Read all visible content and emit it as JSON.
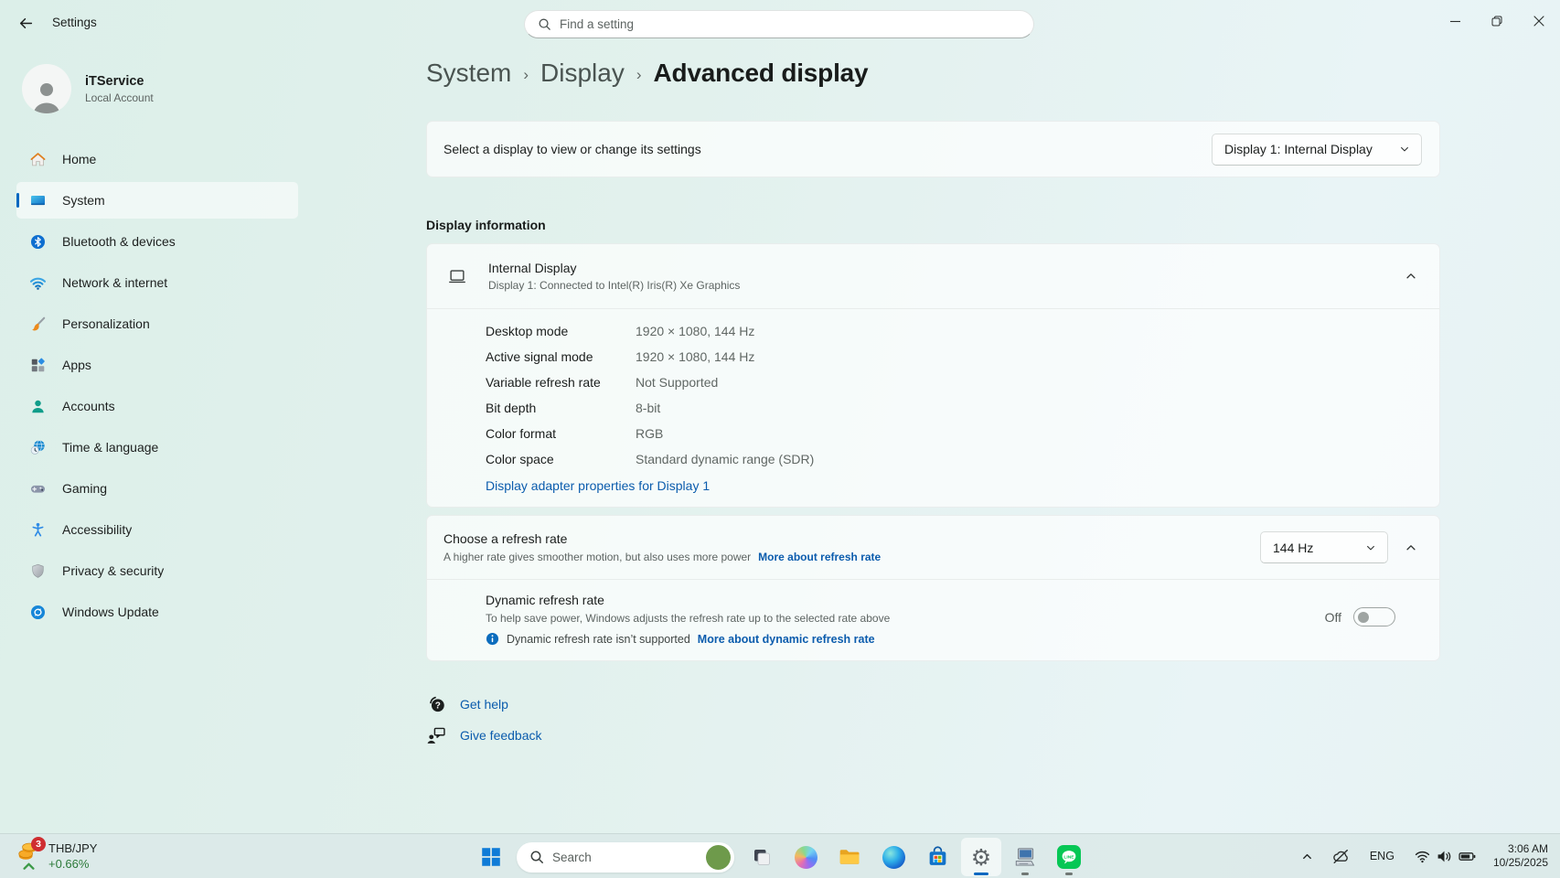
{
  "window": {
    "app_title": "Settings",
    "search_placeholder": "Find a setting"
  },
  "user": {
    "name": "iTService",
    "account_type": "Local Account"
  },
  "sidebar": {
    "items": [
      {
        "label": "Home",
        "icon": "home-icon",
        "selected": false
      },
      {
        "label": "System",
        "icon": "system-icon",
        "selected": true
      },
      {
        "label": "Bluetooth & devices",
        "icon": "bluetooth-icon",
        "selected": false
      },
      {
        "label": "Network & internet",
        "icon": "network-icon",
        "selected": false
      },
      {
        "label": "Personalization",
        "icon": "personalization-icon",
        "selected": false
      },
      {
        "label": "Apps",
        "icon": "apps-icon",
        "selected": false
      },
      {
        "label": "Accounts",
        "icon": "accounts-icon",
        "selected": false
      },
      {
        "label": "Time & language",
        "icon": "time-language-icon",
        "selected": false
      },
      {
        "label": "Gaming",
        "icon": "gaming-icon",
        "selected": false
      },
      {
        "label": "Accessibility",
        "icon": "accessibility-icon",
        "selected": false
      },
      {
        "label": "Privacy & security",
        "icon": "privacy-security-icon",
        "selected": false
      },
      {
        "label": "Windows Update",
        "icon": "windows-update-icon",
        "selected": false
      }
    ]
  },
  "breadcrumb": {
    "crumbs": [
      "System",
      "Display"
    ],
    "current": "Advanced display",
    "separator": "›"
  },
  "selector_card": {
    "label": "Select a display to view or change its settings",
    "value": "Display 1: Internal Display"
  },
  "display_info": {
    "section_title": "Display information",
    "title": "Internal Display",
    "subtitle": "Display 1: Connected to Intel(R) Iris(R) Xe Graphics",
    "rows": [
      {
        "label": "Desktop mode",
        "value": "1920 × 1080, 144 Hz"
      },
      {
        "label": "Active signal mode",
        "value": "1920 × 1080, 144 Hz"
      },
      {
        "label": "Variable refresh rate",
        "value": "Not Supported"
      },
      {
        "label": "Bit depth",
        "value": "8-bit"
      },
      {
        "label": "Color format",
        "value": "RGB"
      },
      {
        "label": "Color space",
        "value": "Standard dynamic range (SDR)"
      }
    ],
    "adapter_link": "Display adapter properties for Display 1"
  },
  "refresh_rate": {
    "title": "Choose a refresh rate",
    "subtitle": "A higher rate gives smoother motion, but also uses more power",
    "more_link": "More about refresh rate",
    "value": "144 Hz"
  },
  "dynamic_refresh": {
    "title": "Dynamic refresh rate",
    "subtitle": "To help save power, Windows adjusts the refresh rate up to the selected rate above",
    "note": "Dynamic refresh rate isn’t supported",
    "more_link": "More about dynamic refresh rate",
    "toggle_state": "Off"
  },
  "footer": {
    "get_help": "Get help",
    "give_feedback": "Give feedback"
  },
  "taskbar": {
    "widget": {
      "badge": "3",
      "pair": "THB/JPY",
      "change": "+0.66%"
    },
    "search_placeholder": "Search",
    "tray": {
      "language": "ENG",
      "time": "3:06 AM",
      "date": "10/25/2025"
    }
  },
  "colors": {
    "accent": "#0067c0",
    "link": "#0b5cad",
    "window_tint": "#e2f1ed"
  }
}
